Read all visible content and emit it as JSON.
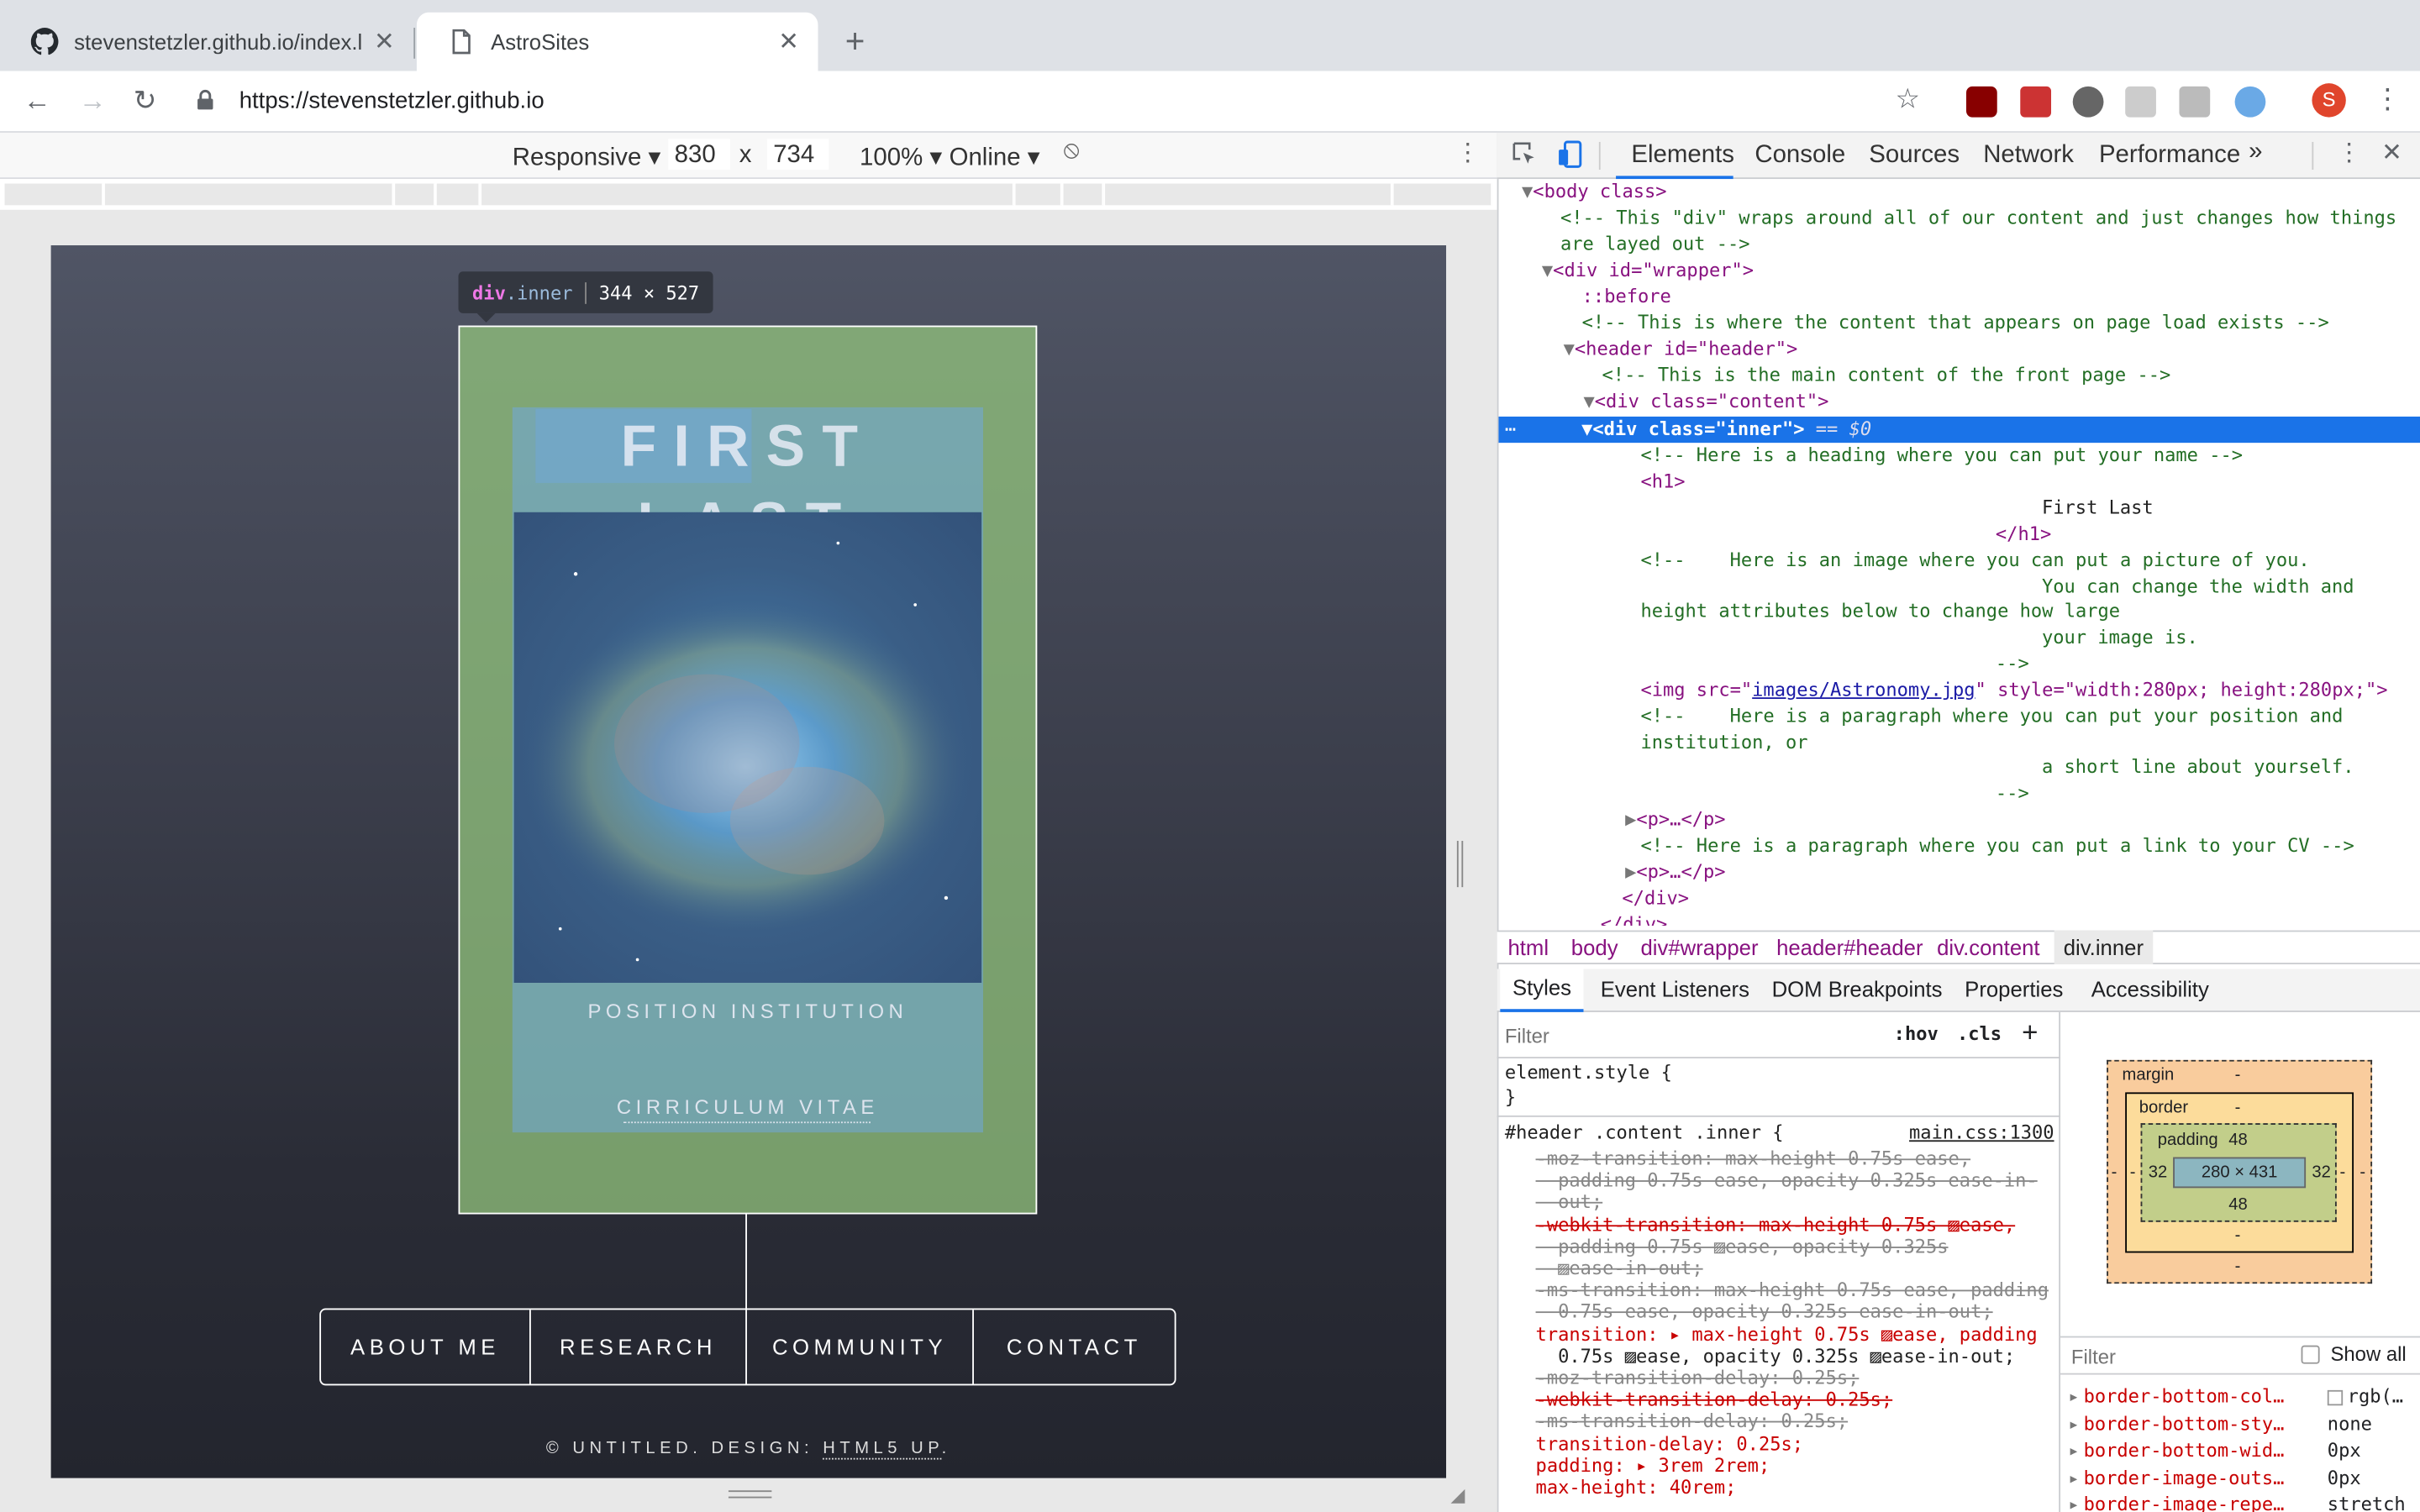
{
  "tabs": [
    {
      "title": "stevenstetzler.github.io/index.l",
      "icon": "github-icon"
    },
    {
      "title": "AstroSites",
      "icon": "document-icon"
    }
  ],
  "new_tab_label": "+",
  "tab_close": "✕",
  "url": "https://stevenstetzler.github.io",
  "profile_initial": "S",
  "device": {
    "mode": "Responsive",
    "width": "830",
    "times": "x",
    "height": "734",
    "zoom": "100%",
    "network": "Online"
  },
  "site": {
    "title": "FIRST LAST",
    "position": "POSITION INSTITUTION",
    "cv": "CIRRICULUM VITAE",
    "nav": [
      "ABOUT ME",
      "RESEARCH",
      "COMMUNITY",
      "CONTACT"
    ],
    "footer_prefix": "© UNTITLED. DESIGN: ",
    "footer_link": "HTML5 UP",
    "footer_suffix": "."
  },
  "tooltip": {
    "tag": "div",
    "cls": ".inner",
    "size": "344 × 527"
  },
  "devtools": {
    "tabs": [
      "Elements",
      "Console",
      "Sources",
      "Network",
      "Performance"
    ],
    "more": "»",
    "dom": {
      "body_open": "<body class>",
      "c1": "<!-- This \"div\" wraps around all of our content and just changes how things",
      "c1b": "are layed out -->",
      "wrapper": "<div id=\"wrapper\">",
      "before": "::before",
      "c2": "<!-- This is where the content that appears on page load exists -->",
      "header": "<header id=\"header\">",
      "c3": "<!-- This is the main content of the front page -->",
      "content": "<div class=\"content\">",
      "inner": "<div class=\"inner\">",
      "inner_suffix": " == $0",
      "c4": "<!-- Here is a heading where you can put your name -->",
      "h1o": "<h1>",
      "h1t": "First Last",
      "h1c": "</h1>",
      "c5a": "<!--    Here is an image where you can put a picture of you.",
      "c5b": "You can change the width and",
      "c5c": "height attributes below to change how large",
      "c5d": "your image is.",
      "c5e": "-->",
      "img_pre": "<img src=\"",
      "img_src": "images/Astronomy.jpg",
      "img_post": "\" style=\"width:280px; height:280px;\">",
      "c6a": "<!--    Here is a paragraph where you can put your position and",
      "c6b": "institution, or",
      "c6c": "a short line about yourself.",
      "c6d": "-->",
      "p1": "<p>…</p>",
      "c7": "<!-- Here is a paragraph where you can put a link to your CV -->",
      "p2": "<p>…</p>",
      "divc": "</div>",
      "divc2": "</div>"
    },
    "breadcrumbs": [
      "html",
      "body",
      "div#wrapper",
      "header#header",
      "div.content",
      "div.inner"
    ],
    "subtabs": [
      "Styles",
      "Event Listeners",
      "DOM Breakpoints",
      "Properties",
      "Accessibility"
    ],
    "filter_placeholder": "Filter",
    "hov": ":hov",
    "cls": ".cls",
    "styles": {
      "el_style": "element.style {",
      "close": "}",
      "selector": "#header .content .inner {",
      "source": "main.css:1300",
      "lines": [
        {
          "t": "-moz-transition: max-height 0.75s ease,",
          "s": true
        },
        {
          "t": "  padding 0.75s ease, opacity 0.325s ease-in-",
          "s": true
        },
        {
          "t": "  out;",
          "s": true
        },
        {
          "t": "-webkit-transition: max-height 0.75s ▨ease,",
          "s": true,
          "red": true
        },
        {
          "t": "  padding 0.75s ▨ease, opacity 0.325s",
          "s": true
        },
        {
          "t": "  ▨ease-in-out;",
          "s": true
        },
        {
          "t": "-ms-transition: max-height 0.75s ease, padding",
          "s": true
        },
        {
          "t": "  0.75s ease, opacity 0.325s ease-in-out;",
          "s": true
        },
        {
          "t": "transition: ▸ max-height 0.75s ▨ease, padding",
          "s": false,
          "red": true
        },
        {
          "t": "  0.75s ▨ease, opacity 0.325s ▨ease-in-out;",
          "s": false
        },
        {
          "t": "-moz-transition-delay: 0.25s;",
          "s": true
        },
        {
          "t": "-webkit-transition-delay: 0.25s;",
          "s": true,
          "red": true
        },
        {
          "t": "-ms-transition-delay: 0.25s;",
          "s": true
        },
        {
          "t": "transition-delay: 0.25s;",
          "s": false,
          "red": true
        },
        {
          "t": "padding: ▸ 3rem 2rem;",
          "s": false,
          "red": true
        },
        {
          "t": "max-height: 40rem;",
          "s": false,
          "red": true
        }
      ]
    },
    "boxmodel": {
      "margin": "margin",
      "border": "border",
      "padding": "padding",
      "pad_val": "48",
      "content": "280 × 431",
      "left": "32",
      "right": "32",
      "bottom": "48",
      "dash": "-"
    },
    "computed_filter": "Filter",
    "show_all": "Show all",
    "computed": [
      {
        "p": "border-bottom-col…",
        "v": "rgb(…"
      },
      {
        "p": "border-bottom-sty…",
        "v": "none"
      },
      {
        "p": "border-bottom-wid…",
        "v": "0px"
      },
      {
        "p": "border-image-outs…",
        "v": "0px"
      },
      {
        "p": "border-image-repe…",
        "v": "stretch"
      }
    ]
  }
}
